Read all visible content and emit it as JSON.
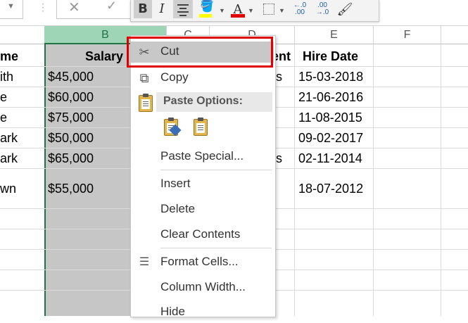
{
  "mini_toolbar": {
    "bold": "B",
    "italic": "I",
    "font_color_letter": "A",
    "increase_decimal": "←.0\n.00",
    "decrease_decimal": ".00\n→.0"
  },
  "columns": [
    "B",
    "C",
    "D",
    "E",
    "F"
  ],
  "headers": {
    "a": "me",
    "b": "Salary",
    "d": "ent",
    "e": "Hire Date"
  },
  "rows": [
    {
      "a": "ith",
      "b": "$45,000",
      "d": "s",
      "e": "15-03-2018"
    },
    {
      "a": "e",
      "b": "$60,000",
      "d": "",
      "e": "21-06-2016"
    },
    {
      "a": "e",
      "b": "$75,000",
      "d": "",
      "e": "11-08-2015"
    },
    {
      "a": "ark",
      "b": "$50,000",
      "d": "",
      "e": "09-02-2017"
    },
    {
      "a": "ark",
      "b": "$65,000",
      "d": "s",
      "e": "02-11-2014"
    },
    {
      "a": "wn",
      "b": "$55,000",
      "d": "",
      "e": "18-07-2012"
    }
  ],
  "context_menu": {
    "cut": "Cut",
    "copy": "Copy",
    "paste_options": "Paste Options:",
    "paste_special": "Paste Special...",
    "insert": "Insert",
    "delete": "Delete",
    "clear_contents": "Clear Contents",
    "format_cells": "Format Cells...",
    "column_width": "Column Width...",
    "hide": "Hide"
  },
  "colors": {
    "selection_green": "#217346",
    "highlight_red": "#e00000"
  }
}
